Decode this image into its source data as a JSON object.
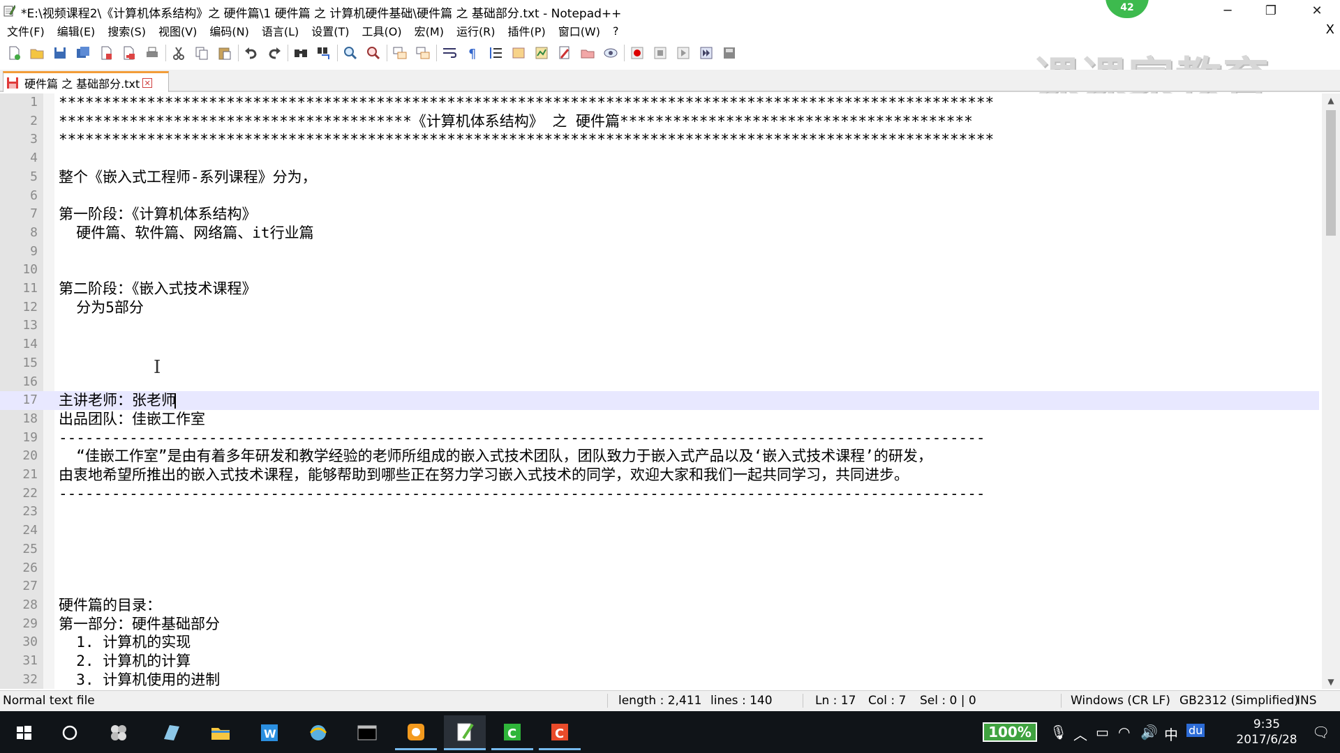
{
  "window": {
    "title": "*E:\\视频课程2\\《计算机体系结构》之 硬件篇\\1 硬件篇 之 计算机硬件基础\\硬件篇 之 基础部分.txt - Notepad++",
    "badge": "42",
    "minimize": "─",
    "restore": "❐",
    "close": "✕"
  },
  "menu": {
    "items": [
      "文件(F)",
      "编辑(E)",
      "搜索(S)",
      "视图(V)",
      "编码(N)",
      "语言(L)",
      "设置(T)",
      "工具(O)",
      "宏(M)",
      "运行(R)",
      "插件(P)",
      "窗口(W)",
      "?"
    ],
    "close_doc": "X"
  },
  "watermark": "课课家教育",
  "tab": {
    "label": "硬件篇 之 基础部分.txt",
    "close": "✕"
  },
  "editor": {
    "current_line": 17,
    "lines": [
      {
        "n": "1",
        "text": "**********************************************************************************************************"
      },
      {
        "n": "2",
        "text": "****************************************《计算机体系结构》 之 硬件篇****************************************"
      },
      {
        "n": "3",
        "text": "**********************************************************************************************************"
      },
      {
        "n": "4",
        "text": ""
      },
      {
        "n": "5",
        "text": "整个《嵌入式工程师-系列课程》分为，"
      },
      {
        "n": "6",
        "text": ""
      },
      {
        "n": "7",
        "text": "第一阶段：《计算机体系结构》"
      },
      {
        "n": "8",
        "text": "  硬件篇、软件篇、网络篇、it行业篇"
      },
      {
        "n": "9",
        "text": ""
      },
      {
        "n": "10",
        "text": ""
      },
      {
        "n": "11",
        "text": "第二阶段：《嵌入式技术课程》"
      },
      {
        "n": "12",
        "text": "  分为5部分"
      },
      {
        "n": "13",
        "text": ""
      },
      {
        "n": "14",
        "text": ""
      },
      {
        "n": "15",
        "text": ""
      },
      {
        "n": "16",
        "text": ""
      },
      {
        "n": "17",
        "text": "主讲老师：张老师"
      },
      {
        "n": "18",
        "text": "出品团队：佳嵌工作室"
      },
      {
        "n": "19",
        "text": "---------------------------------------------------------------------------------------------------------"
      },
      {
        "n": "20",
        "text": "  “佳嵌工作室”是由有着多年研发和教学经验的老师所组成的嵌入式技术团队，团队致力于嵌入式产品以及‘嵌入式技术课程’的研发，"
      },
      {
        "n": "21",
        "text": "由衷地希望所推出的嵌入式技术课程，能够帮助到哪些正在努力学习嵌入式技术的同学，欢迎大家和我们一起共同学习，共同进步。"
      },
      {
        "n": "22",
        "text": "---------------------------------------------------------------------------------------------------------"
      },
      {
        "n": "23",
        "text": ""
      },
      {
        "n": "24",
        "text": ""
      },
      {
        "n": "25",
        "text": ""
      },
      {
        "n": "26",
        "text": ""
      },
      {
        "n": "27",
        "text": ""
      },
      {
        "n": "28",
        "text": "硬件篇的目录："
      },
      {
        "n": "29",
        "text": "第一部分：硬件基础部分"
      },
      {
        "n": "30",
        "text": "  1. 计算机的实现"
      },
      {
        "n": "31",
        "text": "  2. 计算机的计算"
      },
      {
        "n": "32",
        "text": "  3. 计算机使用的进制"
      }
    ]
  },
  "status": {
    "file_type": "Normal text file",
    "length": "length : 2,411",
    "lines": "lines : 140",
    "ln": "Ln : 17",
    "col": "Col : 7",
    "sel": "Sel : 0 | 0",
    "eol": "Windows (CR LF)",
    "encoding": "GB2312 (Simplified)",
    "mode": "INS"
  },
  "taskbar": {
    "battery_pct": "100%",
    "ime": "中",
    "baidu": "du",
    "time": "9:35",
    "date": "2017/6/28",
    "notifications": "1"
  },
  "colors": {
    "tab_accent": "#f29d38",
    "current_line": "#e8e8ff",
    "taskbar_bg": "#101418",
    "badge_green": "#3dba4e"
  }
}
